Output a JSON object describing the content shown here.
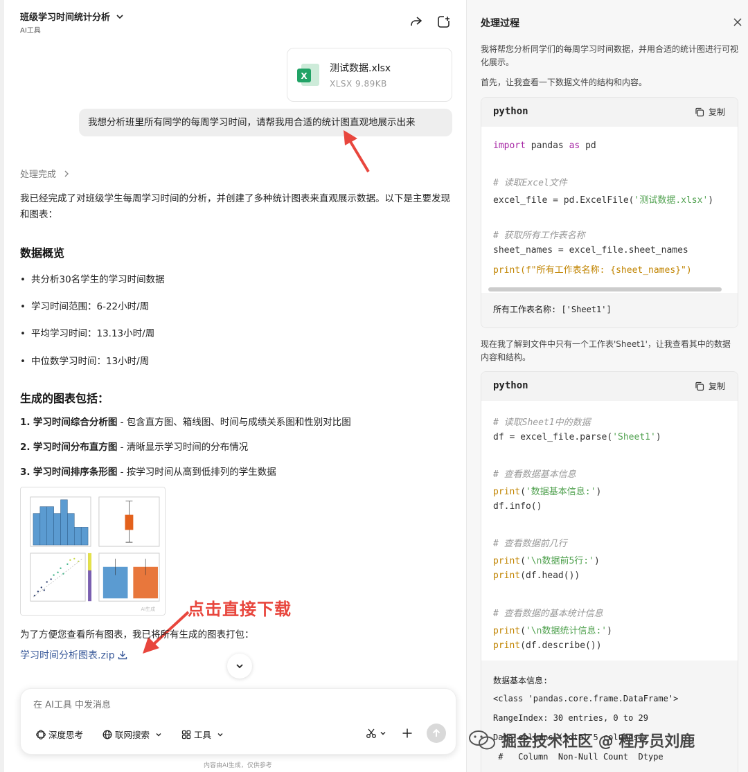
{
  "header": {
    "title": "班级学习时间统计分析",
    "subtitle": "AI工具"
  },
  "file": {
    "name": "测试数据.xlsx",
    "meta": "XLSX   9.89KB",
    "icon_letter": "X"
  },
  "user_message": "我想分析班里所有同学的每周学习时间，请帮我用合适的统计图直观地展示出来",
  "process_status": "处理完成",
  "intro": "我已经完成了对班级学生每周学习时间的分析，并创建了多种统计图表来直观展示数据。以下是主要发现和图表：",
  "overview": {
    "heading": "数据概览",
    "bullets": [
      "共分析30名学生的学习时间数据",
      "学习时间范围：6-22小时/周",
      "平均学习时间：13.13小时/周",
      "中位数学习时间：13小时/周"
    ]
  },
  "charts": {
    "heading": "生成的图表包括：",
    "items": [
      {
        "num": "1.",
        "name": "学习时间综合分析图",
        "desc": " - 包含直方图、箱线图、时间与成绩关系图和性别对比图"
      },
      {
        "num": "2.",
        "name": "学习时间分布直方图",
        "desc": " - 清晰显示学习时间的分布情况"
      },
      {
        "num": "3.",
        "name": "学习时间排序条形图",
        "desc": " - 按学习时间从高到低排列的学生数据"
      }
    ]
  },
  "annotation": "点击直接下载",
  "pack_text": "为了方便您查看所有图表，我已将所有生成的图表打包：",
  "zip_link": "学习时间分析图表.zip",
  "input": {
    "placeholder": "在 AI工具 中发消息",
    "tools": [
      "深度思考",
      "联网搜索",
      "工具"
    ]
  },
  "disclaimer": "内容由AI生成，仅供参考",
  "right_panel": {
    "title": "处理过程",
    "text1": "我将帮您分析同学们的每周学习时间数据，并用合适的统计图进行可视化展示。",
    "text2": "首先，让我查看一下数据文件的结构和内容。",
    "text3": "现在我了解到文件中只有一个工作表'Sheet1'，让我查看其中的数据内容和结构。",
    "copy_label": "复制",
    "lang": "python",
    "code1": [
      "import pandas as pd",
      "",
      "# 读取Excel文件",
      "excel_file = pd.ExcelFile('测试数据.xlsx')",
      "",
      "# 获取所有工作表名称",
      "sheet_names = excel_file.sheet_names",
      "print(f\"所有工作表名称: {sheet_names}\")"
    ],
    "output1": "所有工作表名称: ['Sheet1']",
    "code2": [
      "# 读取Sheet1中的数据",
      "df = excel_file.parse('Sheet1')",
      "",
      "# 查看数据基本信息",
      "print('数据基本信息:')",
      "df.info()",
      "",
      "# 查看数据前几行",
      "print('\\n数据前5行:')",
      "print(df.head())",
      "",
      "# 查看数据的基本统计信息",
      "print('\\n数据统计信息:')",
      "print(df.describe())"
    ],
    "output2": [
      "数据基本信息:",
      "<class 'pandas.core.frame.DataFrame'>",
      "RangeIndex: 30 entries, 0 to 29",
      "Data columns (total 5 columns):",
      " #   Column  Non-Null Count  Dtype"
    ]
  },
  "watermark": "掘金技术社区 @ 程序员刘鹿",
  "thumb_watermark": "AI生成",
  "colors": {
    "accent_red": "#e8463d",
    "link_blue": "#3a5a9a",
    "excel_green": "#21a366"
  }
}
